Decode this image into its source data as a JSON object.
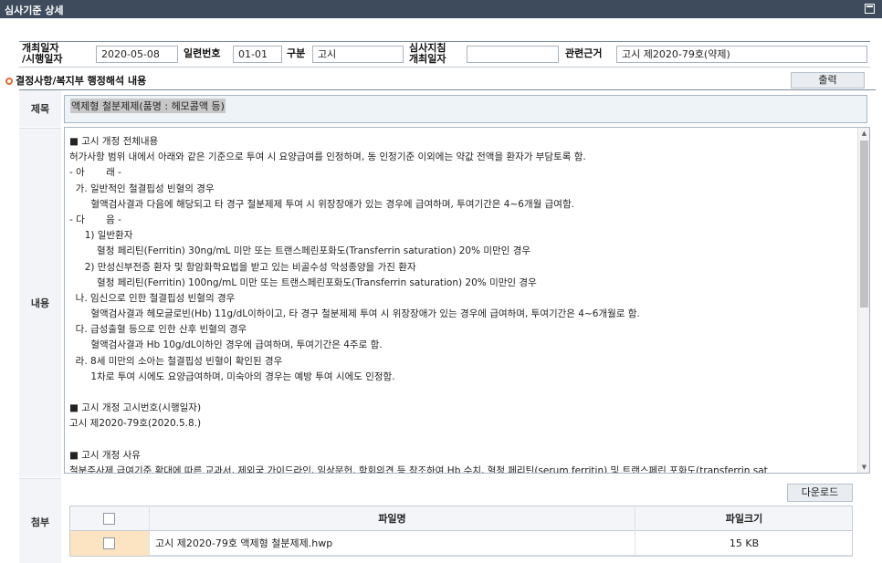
{
  "window": {
    "title": "심사기준 상세"
  },
  "info": {
    "date_label": "개최일자\n/시행일자",
    "date_value": "2020-05-08",
    "serial_label": "일련번호",
    "serial_value": "01-01",
    "type_label": "구분",
    "type_value": "고시",
    "guideline_label": "심사지침\n개최일자",
    "guideline_value": "",
    "basis_label": "관련근거",
    "basis_value": "고시 제2020-79호(약제)"
  },
  "section": {
    "title": "결정사항/복지부 행정해석 내용",
    "print_label": "출력"
  },
  "subject": {
    "label": "제목",
    "value": "액제형 철분제제(품명 : 헤모콤액 등)"
  },
  "content": {
    "label": "내용",
    "lines": [
      "■ 고시 개정 전체내용",
      "허가사항 범위 내에서 아래와 같은 기준으로 투여 시 요양급여를 인정하며, 동 인정기준 이외에는 약값 전액을 환자가 부담토록 함.",
      "- 아       래 -",
      "  가. 일반적인 철결핍성 빈혈의 경우",
      "       혈액검사결과 다음에 해당되고 타 경구 철분제제 투여 시 위장장애가 있는 경우에 급여하며, 투여기간은 4~6개월 급여함.",
      "- 다       음 -",
      "     1) 일반환자",
      "         혈청 페리틴(Ferritin) 30ng/mL 미만 또는 트랜스페린포화도(Transferrin saturation) 20% 미만인 경우",
      "     2) 만성신부전증 환자 및 항암화학요법을 받고 있는 비골수성 악성종양을 가진 환자",
      "         혈청 페리틴(Ferritin) 100ng/mL 미만 또는 트랜스페린포화도(Transferrin saturation) 20% 미만인 경우",
      "  나. 임신으로 인한 철결핍성 빈혈의 경우",
      "       혈액검사결과 헤모글로빈(Hb) 11g/dL이하이고, 타 경구 철분제제 투여 시 위장장애가 있는 경우에 급여하며, 투여기간은 4~6개월로 함.",
      "  다. 급성출혈 등으로 인한 산후 빈혈의 경우",
      "       혈액검사결과 Hb 10g/dL이하인 경우에 급여하며, 투여기간은 4주로 함.",
      "  라. 8세 미만의 소아는 철결핍성 빈혈이 확인된 경우",
      "       1차로 투여 시에도 요양급여하며, 미숙아의 경우는 예방 투여 시에도 인정함.",
      "",
      "■ 고시 개정 고시번호(시행일자)",
      "고시 제2020-79호(2020.5.8.)",
      "",
      "■ 고시 개정 사유",
      "철분주사제 급여기준 확대에 따른 교과서, 제외국 가이드라인, 임상문헌, 학회의견 등 참조하여 Hb 수치, 혈청 페리틴(serum ferritin) 및 트랜스페린 포화도(transferrin sat"
    ]
  },
  "attachment": {
    "label": "첨부",
    "download_label": "다운로드",
    "header_filename": "파일명",
    "header_filesize": "파일크기",
    "files": [
      {
        "name": "고시 제2020-79호 액제형 철분제제.hwp",
        "size": "15 KB"
      }
    ]
  }
}
